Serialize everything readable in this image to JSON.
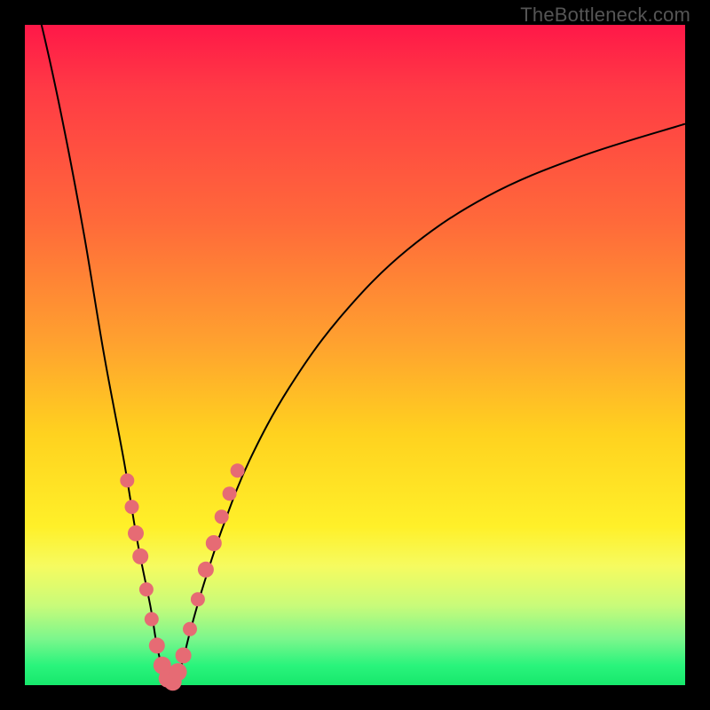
{
  "watermark_text": "TheBottleneck.com",
  "colors": {
    "marker": "#e66b74",
    "curve": "#000000",
    "gradient_top": "#ff1848",
    "gradient_bottom": "#17e86c",
    "frame": "#000000"
  },
  "chart_data": {
    "type": "line",
    "title": "",
    "xlabel": "",
    "ylabel": "",
    "xlim": [
      0,
      100
    ],
    "ylim": [
      0,
      100
    ],
    "grid": false,
    "legend": false,
    "description": "Bottleneck-percentage curve. Y ~ 0 near x≈22 (optimal region); rises steeply to ~100 as x→0 and more gently toward ~85 as x→100. Background gradient encodes score: green (low y) → red (high y).",
    "optimal_x": 22,
    "series": [
      {
        "name": "bottleneck-curve",
        "x": [
          0,
          3,
          6,
          9,
          12,
          15,
          17,
          19,
          20,
          21,
          22,
          23,
          24,
          25,
          27,
          30,
          34,
          40,
          48,
          58,
          70,
          84,
          100
        ],
        "values": [
          110,
          98,
          84,
          68,
          50,
          34,
          22,
          12,
          6,
          2,
          0,
          1,
          4,
          8,
          15,
          24,
          34,
          45,
          56,
          66,
          74,
          80,
          85
        ]
      }
    ],
    "markers": {
      "name": "highlighted-points",
      "x": [
        15.5,
        16.2,
        16.8,
        17.5,
        18.4,
        19.2,
        20.0,
        20.8,
        21.6,
        22.4,
        23.2,
        24.0,
        25.0,
        26.2,
        27.4,
        28.6,
        29.8,
        31.0,
        32.2
      ],
      "values": [
        31.0,
        27.0,
        23.0,
        19.5,
        14.5,
        10.0,
        6.0,
        3.0,
        1.0,
        0.5,
        2.0,
        4.5,
        8.5,
        13.0,
        17.5,
        21.5,
        25.5,
        29.0,
        32.5
      ],
      "radius": [
        8,
        8,
        9,
        9,
        8,
        8,
        9,
        10,
        10,
        10,
        10,
        9,
        8,
        8,
        9,
        9,
        8,
        8,
        8
      ]
    }
  }
}
